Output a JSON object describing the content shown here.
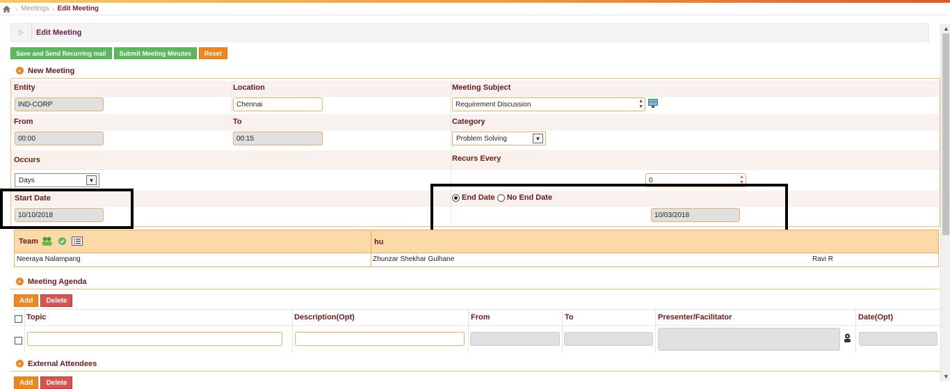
{
  "breadcrumb": {
    "items": [
      "Meetings",
      "Edit Meeting"
    ]
  },
  "panel": {
    "title": "Edit Meeting"
  },
  "toolbar": {
    "save_send": "Save and Send Recurring mail",
    "submit_minutes": "Submit Meeting Minutes",
    "reset": "Reset"
  },
  "new_meeting": {
    "title": "New Meeting",
    "entity": {
      "label": "Entity",
      "value": "IND-CORP"
    },
    "location": {
      "label": "Location",
      "value": "Chennai"
    },
    "subject": {
      "label": "Meeting Subject",
      "value": "Requirement Discussion"
    },
    "from": {
      "label": "From",
      "value": "00:00"
    },
    "to": {
      "label": "To",
      "value": "00:15"
    },
    "category": {
      "label": "Category",
      "value": "Problem Solving"
    },
    "occurs": {
      "label": "Occurs",
      "value": "Days"
    },
    "recurs_every": {
      "label": "Recurs Every",
      "value": "0"
    },
    "start_date": {
      "label": "Start Date",
      "value": "10/10/2018"
    },
    "end_date_option": "End Date",
    "no_end_date_option": "No End Date",
    "end_date": {
      "value": "10/03/2018"
    }
  },
  "team": {
    "label": "Team",
    "col2": "hu",
    "members": [
      "Neeraya Nalampang",
      "Zhunzar Shekhar Gulhane",
      "Ravi R"
    ]
  },
  "agenda": {
    "title": "Meeting Agenda",
    "add": "Add",
    "delete": "Delete",
    "columns": [
      "Topic",
      "Description(Opt)",
      "From",
      "To",
      "Presenter/Facilitator",
      "Date(Opt)"
    ]
  },
  "external": {
    "title": "External Attendees",
    "add": "Add",
    "delete": "Delete"
  },
  "colors": {
    "accent": "#f0861e",
    "green": "#5cb85c",
    "label": "#6b1a1a",
    "border": "#e8b060"
  }
}
